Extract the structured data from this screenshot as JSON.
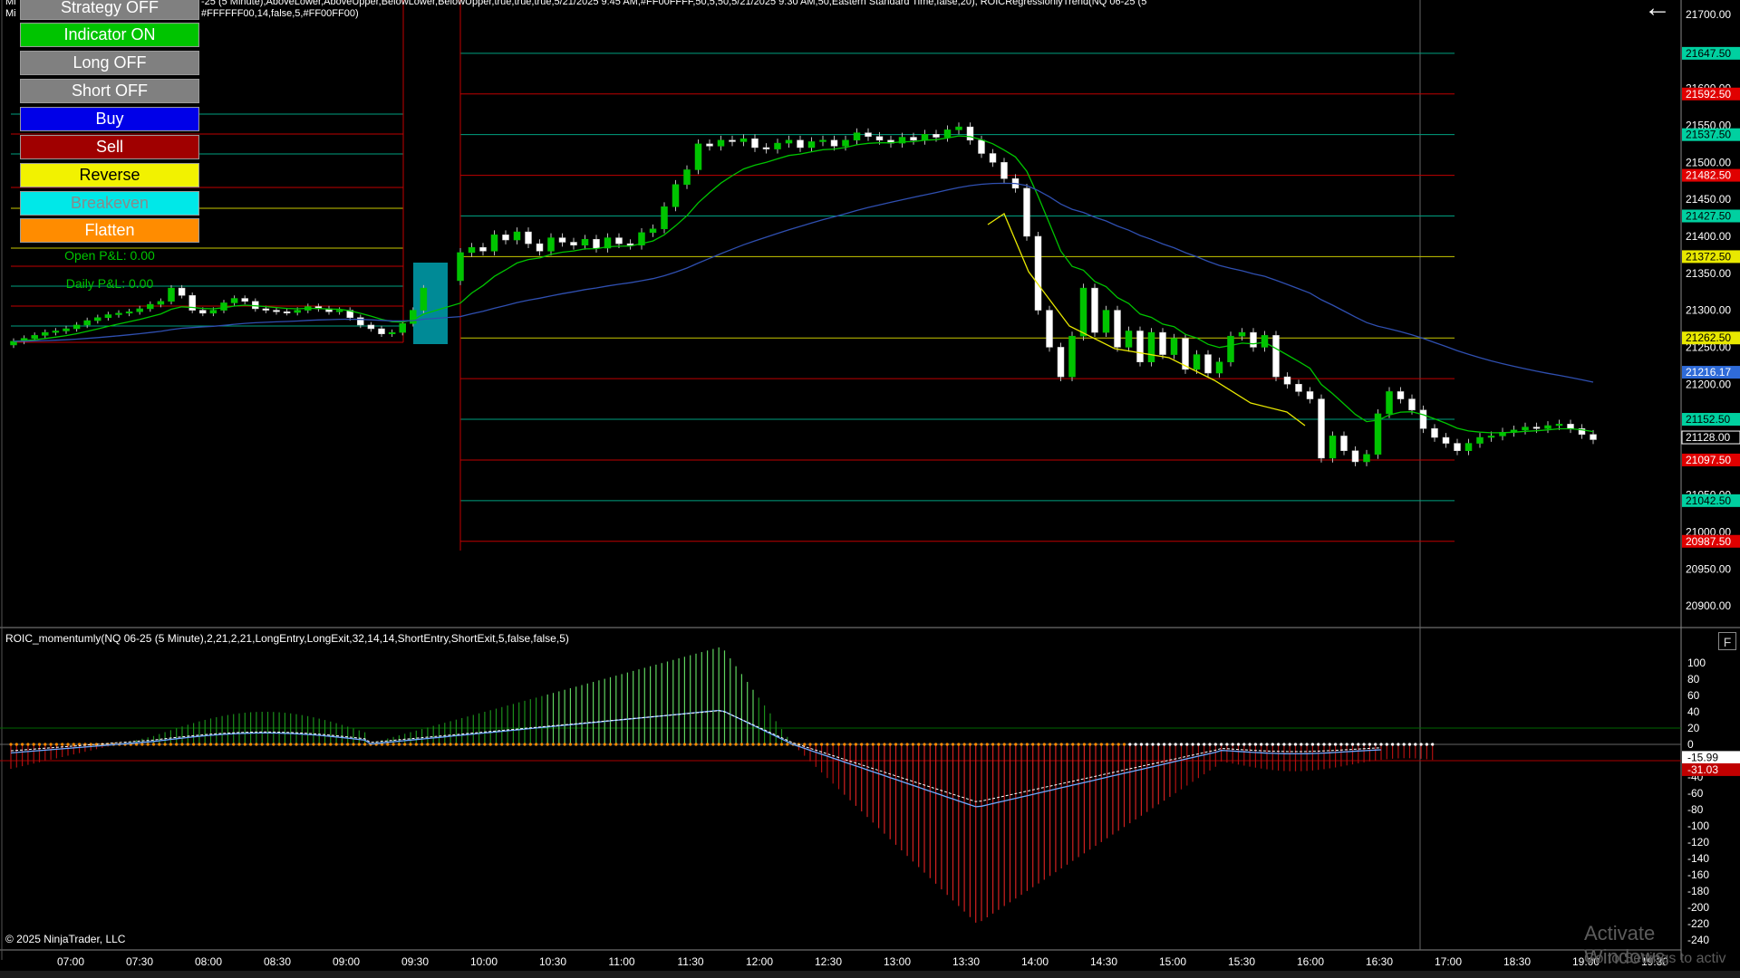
{
  "header": {
    "line1": "-25 (5 Minute),AboveLower,AboveUpper,BelowLower,BelowUpper,true,true,true,5/21/2025 9:45 AM,#FF00FFFF,50,5,50,5/21/2025 9:30 AM,50,Eastern Standard Time,false,20), ROICRegressionlyTrend(NQ 06-25 (5",
    "line2_prefix": "Mi",
    "line2": "#FFFFFF00,14,false,5,#FF00FF00)"
  },
  "controls": {
    "buttons": [
      {
        "label": "Strategy OFF",
        "bg": "#808080",
        "fg": "#ffffff"
      },
      {
        "label": "Indicator ON",
        "bg": "#00c400",
        "fg": "#ffffff"
      },
      {
        "label": "Long OFF",
        "bg": "#808080",
        "fg": "#ffffff"
      },
      {
        "label": "Short OFF",
        "bg": "#808080",
        "fg": "#ffffff"
      },
      {
        "label": "Buy",
        "bg": "#0000e8",
        "fg": "#ffffff"
      },
      {
        "label": "Sell",
        "bg": "#a00000",
        "fg": "#ffffff"
      },
      {
        "label": "Reverse",
        "bg": "#f2f200",
        "fg": "#000000"
      },
      {
        "label": "Breakeven",
        "bg": "#00e8e8",
        "fg": "#8a8a8a"
      },
      {
        "label": "Flatten",
        "bg": "#ff8c00",
        "fg": "#ffffff"
      }
    ],
    "open_pnl": "Open P&L: 0.00",
    "daily_pnl": "Daily P&L: 0.00"
  },
  "price_axis": {
    "ticks": [
      "21700.00",
      "21650.00",
      "21600.00",
      "21550.00",
      "21500.00",
      "21450.00",
      "21400.00",
      "21350.00",
      "21300.00",
      "21250.00",
      "21200.00",
      "21150.00",
      "21100.00",
      "21050.00",
      "21000.00",
      "20950.00",
      "20900.00"
    ],
    "level_labels": [
      {
        "text": "21647.50",
        "color": "#00d0a0"
      },
      {
        "text": "21592.50",
        "color": "#e00000"
      },
      {
        "text": "21537.50",
        "color": "#00d0a0"
      },
      {
        "text": "21482.50",
        "color": "#e00000"
      },
      {
        "text": "21427.50",
        "color": "#00d0a0"
      },
      {
        "text": "21372.50",
        "color": "#e8e800"
      },
      {
        "text": "21262.50",
        "color": "#e8e800"
      },
      {
        "text": "21216.17",
        "color": "#2f6bd8"
      },
      {
        "text": "21152.50",
        "color": "#00d0a0"
      },
      {
        "text": "21128.00",
        "color": "#ffffff"
      },
      {
        "text": "21097.50",
        "color": "#e00000"
      },
      {
        "text": "21042.50",
        "color": "#00d0a0"
      },
      {
        "text": "20987.50",
        "color": "#e00000"
      }
    ]
  },
  "indicator": {
    "title": "ROIC_momentumly(NQ 06-25 (5 Minute),2,21,2,21,LongEntry,LongExit,32,14,14,ShortEntry,ShortExit,5,false,false,5)",
    "ticks": [
      "100",
      "80",
      "60",
      "40",
      "20",
      "0",
      "-20",
      "-40",
      "-60",
      "-80",
      "-100",
      "-120",
      "-140",
      "-160",
      "-180",
      "-200",
      "-220",
      "-240"
    ],
    "value_white": "-15.99",
    "value_red": "-31.03",
    "f_label": "F"
  },
  "time_axis": [
    "07:00",
    "07:30",
    "08:00",
    "08:30",
    "09:00",
    "09:30",
    "10:00",
    "10:30",
    "11:00",
    "11:30",
    "12:00",
    "12:30",
    "13:00",
    "13:30",
    "14:00",
    "14:30",
    "15:00",
    "15:30",
    "16:00",
    "16:30",
    "17:00",
    "18:30",
    "19:00",
    "19:30"
  ],
  "footer": {
    "copyright": "© 2025 NinjaTrader, LLC",
    "watermark_1": "Activate Windows",
    "watermark_2": "Go to Settings to activ"
  },
  "colors": {
    "bull": "#00c400",
    "bear": "#ffffff",
    "level_green": "#00a080",
    "level_red": "#c00000",
    "level_yellow": "#c8c800",
    "sma_blue": "#2f4fb0",
    "ema_yellow": "#e8e800",
    "ema_green": "#00c400"
  }
}
